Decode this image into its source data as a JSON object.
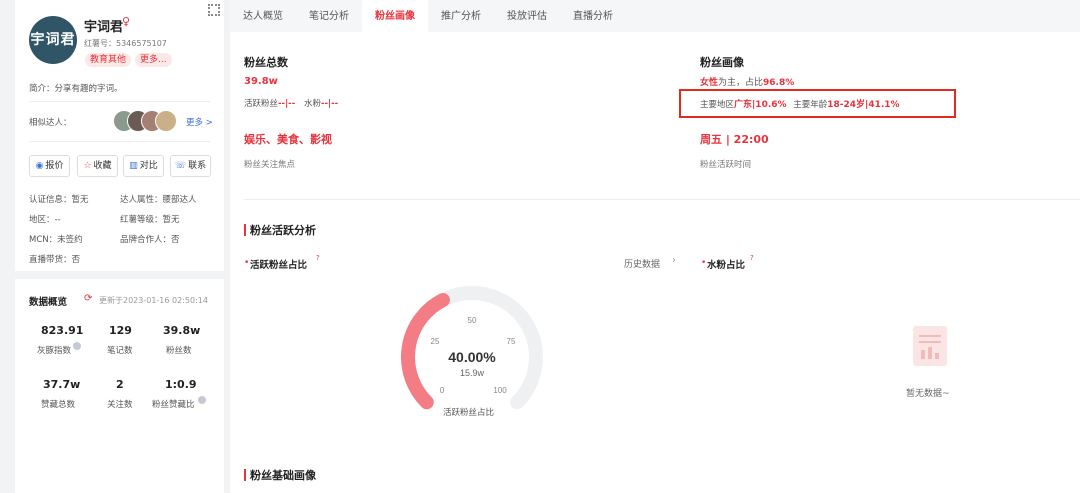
{
  "profile": {
    "avatar_text": "宇词君",
    "name": "宇词君",
    "gender_icon": "female-icon",
    "id_label": "红薯号：5346575107",
    "tags": [
      "教育其他",
      "更多..."
    ],
    "bio": "简介：分享有趣的字词。",
    "similar_label": "相似达人：",
    "similar_more": "更多 >",
    "corner_icon": "qrcode-icon"
  },
  "actions": [
    {
      "icon": "quote-icon",
      "glyph": "◉",
      "label": "报价"
    },
    {
      "icon": "star-icon",
      "glyph": "☆",
      "label": "收藏"
    },
    {
      "icon": "compare-icon",
      "glyph": "▥",
      "label": "对比"
    },
    {
      "icon": "phone-icon",
      "glyph": "☏",
      "label": "联系"
    }
  ],
  "info": {
    "certification": "认证信息：暂无",
    "attribute": "达人属性：腰部达人",
    "region": "地区：--",
    "level": "红薯等级：暂无",
    "mcn": "MCN：未签约",
    "brand_partner": "品牌合作人：否",
    "live_goods": "直播带货：否"
  },
  "overview": {
    "title": "数据概览",
    "updated": "更新于2023-01-16 02:50:14",
    "stats": [
      {
        "value": "823.91",
        "label": "灰豚指数"
      },
      {
        "value": "129",
        "label": "笔记数"
      },
      {
        "value": "39.8w",
        "label": "粉丝数"
      },
      {
        "value": "37.7w",
        "label": "赞藏总数"
      },
      {
        "value": "2",
        "label": "关注数"
      },
      {
        "value": "1:0.9",
        "label": "粉丝赞藏比"
      }
    ]
  },
  "tabs": [
    "达人概览",
    "笔记分析",
    "粉丝画像",
    "推广分析",
    "投放评估",
    "直播分析"
  ],
  "active_tab": 2,
  "fans": {
    "total_title": "粉丝总数",
    "total_value": "39.8w",
    "active_label": "活跃粉丝",
    "active_value": "--|--",
    "water_label": "水粉",
    "water_value": "--|--",
    "focus_value": "娱乐、美食、影视",
    "focus_label": "粉丝关注焦点",
    "portrait_title": "粉丝画像",
    "gender_value": "女性",
    "gender_mid": "为主，占比",
    "gender_pct": "96.8%",
    "region_label": "主要地区",
    "region_value": "广东|10.6%",
    "age_label": "主要年龄",
    "age_value": "18-24岁|41.1%",
    "time_value": "周五 | 22:00",
    "time_label": "粉丝活跃时间"
  },
  "activity": {
    "section_title": "粉丝活跃分析",
    "active_ratio_title": "活跃粉丝占比",
    "history_link": "历史数据",
    "water_ratio_title": "水粉占比",
    "gauge_percent": 40,
    "gauge_value": "40.00%",
    "gauge_sub": "15.9w",
    "gauge_caption": "活跃粉丝占比",
    "ticks": [
      "0",
      "25",
      "50",
      "75",
      "100"
    ],
    "empty_text": "暂无数据~"
  },
  "basic_section_title": "粉丝基础画像",
  "colors": {
    "accent": "#e8323c",
    "gauge_fill": "#f47c84",
    "avatar_bg": "#2f5566"
  }
}
